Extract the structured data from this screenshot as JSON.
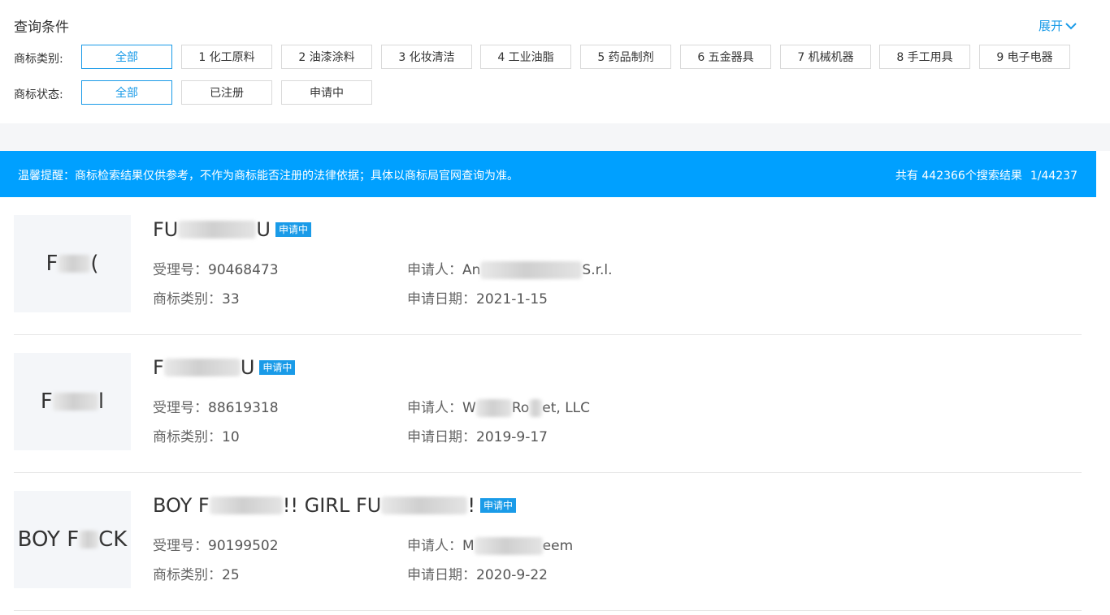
{
  "filters": {
    "title": "查询条件",
    "expand_label": "展开",
    "category": {
      "label": "商标类别:",
      "options": [
        "全部",
        "1 化工原料",
        "2 油漆涂料",
        "3 化妆清洁",
        "4 工业油脂",
        "5 药品制剂",
        "6 五金器具",
        "7 机械机器",
        "8 手工用具",
        "9 电子电器"
      ],
      "selected": "全部"
    },
    "status": {
      "label": "商标状态:",
      "options": [
        "全部",
        "已注册",
        "申请中"
      ],
      "selected": "全部"
    }
  },
  "notice": {
    "text": "温馨提醒：商标检索结果仅供参考，不作为商标能否注册的法律依据；具体以商标局官网查询为准。",
    "count_prefix": "共有 ",
    "count": "442366",
    "count_suffix": "个搜索结果",
    "page": "1/44237"
  },
  "labels": {
    "app_no": "受理号：",
    "category": "商标类别：",
    "applicant": "申请人：",
    "date": "申请日期："
  },
  "results": [
    {
      "thumb_head": "F",
      "thumb_tail": "(",
      "name_head": "FU",
      "name_tail": "U",
      "badge": "申请中",
      "app_no": "90468473",
      "category": "33",
      "applicant_head": "An",
      "applicant_tail": "S.r.l.",
      "date": "2021-1-15"
    },
    {
      "thumb_head": "F",
      "thumb_tail": "l",
      "name_head": "F",
      "name_tail": "U",
      "badge": "申请中",
      "app_no": "88619318",
      "category": "10",
      "applicant_head": "W",
      "applicant_mid": "Ro",
      "applicant_tail": "et, LLC",
      "date": "2019-9-17"
    },
    {
      "thumb_head": "BOY F",
      "thumb_tail": "CK",
      "name_head": "BOY F",
      "name_mid": "!! GIRL FU",
      "name_tail": "!",
      "badge": "申请中",
      "app_no": "90199502",
      "category": "25",
      "applicant_head": "M",
      "applicant_tail": "eem",
      "date": "2020-9-22"
    }
  ]
}
